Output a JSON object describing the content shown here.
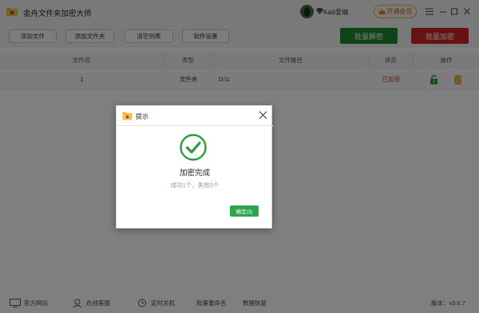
{
  "app": {
    "title": "金舟文件夹加密大师"
  },
  "user": {
    "name": "Kaili爱编"
  },
  "header": {
    "vip_label": "开通会员"
  },
  "toolbar": {
    "add_file": "添加文件",
    "add_folder": "添加文件夹",
    "clear_list": "清空列表",
    "settings": "软件设置",
    "batch_decrypt": "批量解密",
    "batch_encrypt": "批量加密"
  },
  "table": {
    "headers": [
      "文件名",
      "类型",
      "文件路径",
      "状态",
      "操作"
    ],
    "rows": [
      {
        "name": "1",
        "type": "文件夹",
        "path": "D:\\1",
        "status": "已加密"
      }
    ]
  },
  "dialog": {
    "title": "提示",
    "message": "加密完成",
    "detail": "成功1个，失败0个",
    "ok_label": "确定(3)"
  },
  "statusbar": {
    "website": "官方网站",
    "support": "在线客服",
    "shutdown": "定时关机",
    "rename": "批量重命名",
    "recovery": "数据恢复",
    "version": "版本：v3.6.7"
  },
  "colors": {
    "decrypt_green": "#1a8a2e",
    "encrypt_red": "#d02727",
    "status_red": "#d33a3a",
    "ok_green": "#2ea44f",
    "lock_green": "#2e9b3a",
    "trash_orange": "#e09a2a"
  }
}
